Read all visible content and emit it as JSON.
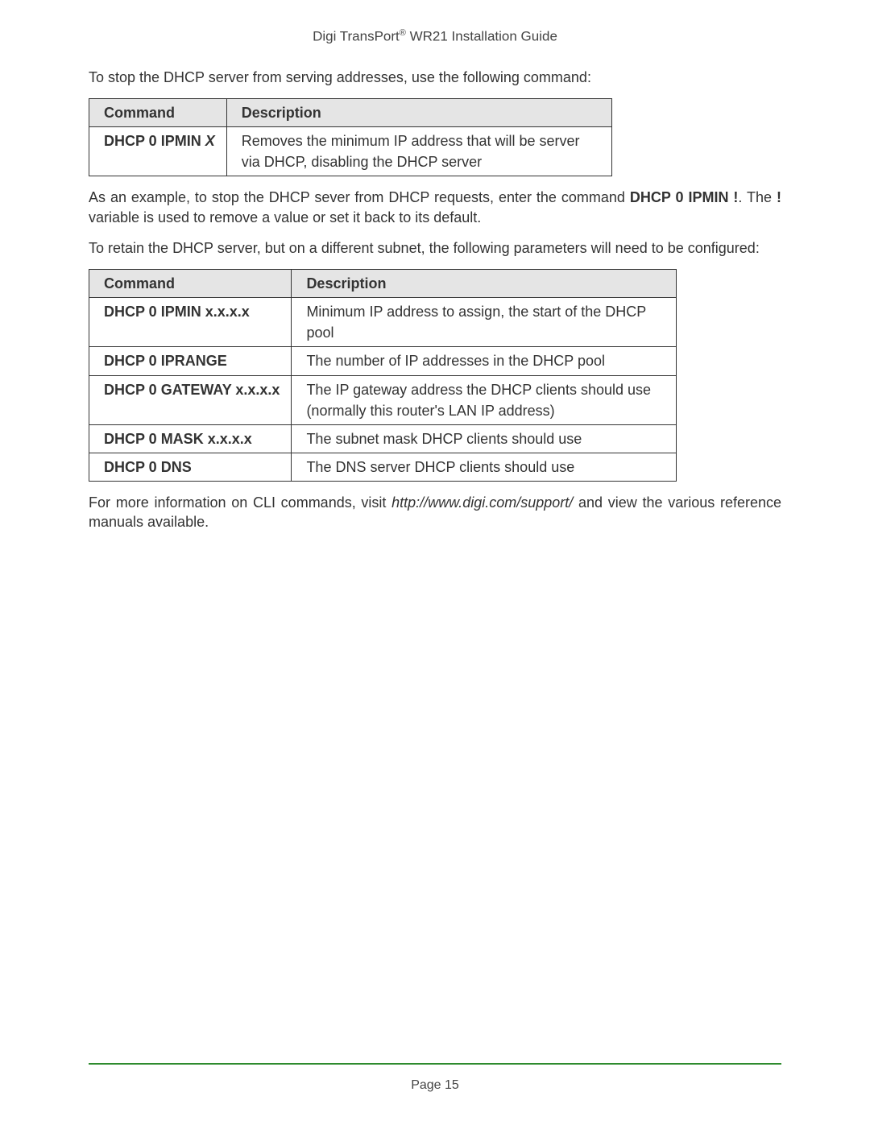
{
  "header": {
    "prefix": "Digi TransPort",
    "reg": "®",
    "suffix": " WR21 Installation Guide"
  },
  "para1": "To stop the DHCP server from serving addresses, use the following command:",
  "table1": {
    "headers": {
      "cmd": "Command",
      "desc": "Description"
    },
    "row": {
      "cmd_text": "DHCP 0 IPMIN ",
      "cmd_var": "X",
      "desc": "Removes the minimum IP address that will be server via DHCP, disabling the DHCP server"
    }
  },
  "para2": {
    "p1": "As an example, to stop the DHCP sever from DHCP requests, enter the command ",
    "bold1": "DHCP 0 IPMIN !",
    "p2": ". The ",
    "bold2": "!",
    "p3": " variable is used to remove a value or set it back to its default."
  },
  "para3": "To retain the DHCP server, but on a different subnet, the following parameters will need to be configured:",
  "table2": {
    "headers": {
      "cmd": "Command",
      "desc": "Description"
    },
    "rows": [
      {
        "cmd": "DHCP 0 IPMIN x.x.x.x",
        "desc": "Minimum IP address to assign, the start of the DHCP pool"
      },
      {
        "cmd": "DHCP 0 IPRANGE",
        "desc": "The number of IP addresses in the DHCP pool"
      },
      {
        "cmd": "DHCP 0 GATEWAY x.x.x.x",
        "desc": "The IP gateway address the DHCP clients should use (normally this router's LAN IP address)"
      },
      {
        "cmd": "DHCP 0 MASK x.x.x.x",
        "desc": "The subnet mask DHCP clients should use"
      },
      {
        "cmd": "DHCP 0 DNS",
        "desc": "The DNS server DHCP clients should use"
      }
    ]
  },
  "para4": {
    "p1": "For more information on CLI commands, visit ",
    "link": "http://www.digi.com/support/",
    "p2": " and view the various reference manuals available."
  },
  "footer": "Page 15"
}
